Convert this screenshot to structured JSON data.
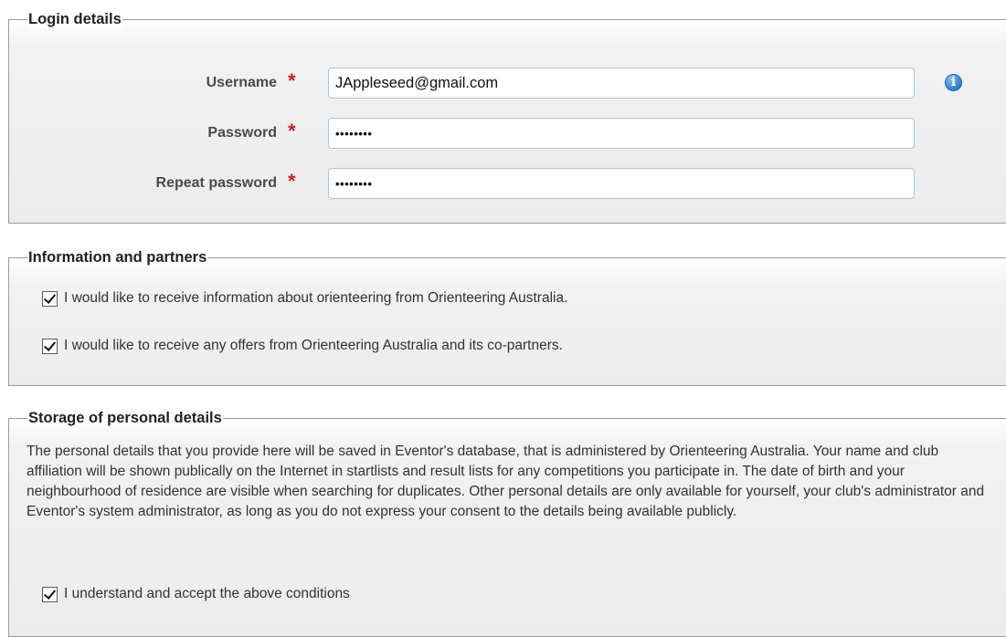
{
  "login": {
    "legend": "Login details",
    "username_label": "Username",
    "username_value": "JAppleseed@gmail.com",
    "password_label": "Password",
    "password_value": "••••••••",
    "repeat_label": "Repeat password",
    "repeat_value": "••••••••",
    "required_mark": "*",
    "info_icon": "i"
  },
  "info": {
    "legend": "Information and partners",
    "options": [
      {
        "label": "I would like to receive information about orienteering from Orienteering Australia.",
        "checked": true
      },
      {
        "label": "I would like to receive any offers from Orienteering Australia and its co-partners.",
        "checked": true
      }
    ]
  },
  "storage": {
    "legend": "Storage of personal details",
    "text": "The personal details that you provide here will be saved in Eventor's database, that is administered by Orienteering Australia. Your name and club affiliation will be shown publically on the Internet in startlists and result lists for any competitions you participate in. The date of birth and your neighbourhood of residence are visible when searching for duplicates. Other personal details are only available for yourself, your club's administrator and Eventor's system administrator, as long as you do not express your consent to the details being available publicly.",
    "accept_label": "I understand and accept the above conditions",
    "accept_checked": true
  },
  "colors": {
    "required": "#d42020",
    "input_border": "#aac4e4",
    "info_icon": "#3a86d6"
  }
}
